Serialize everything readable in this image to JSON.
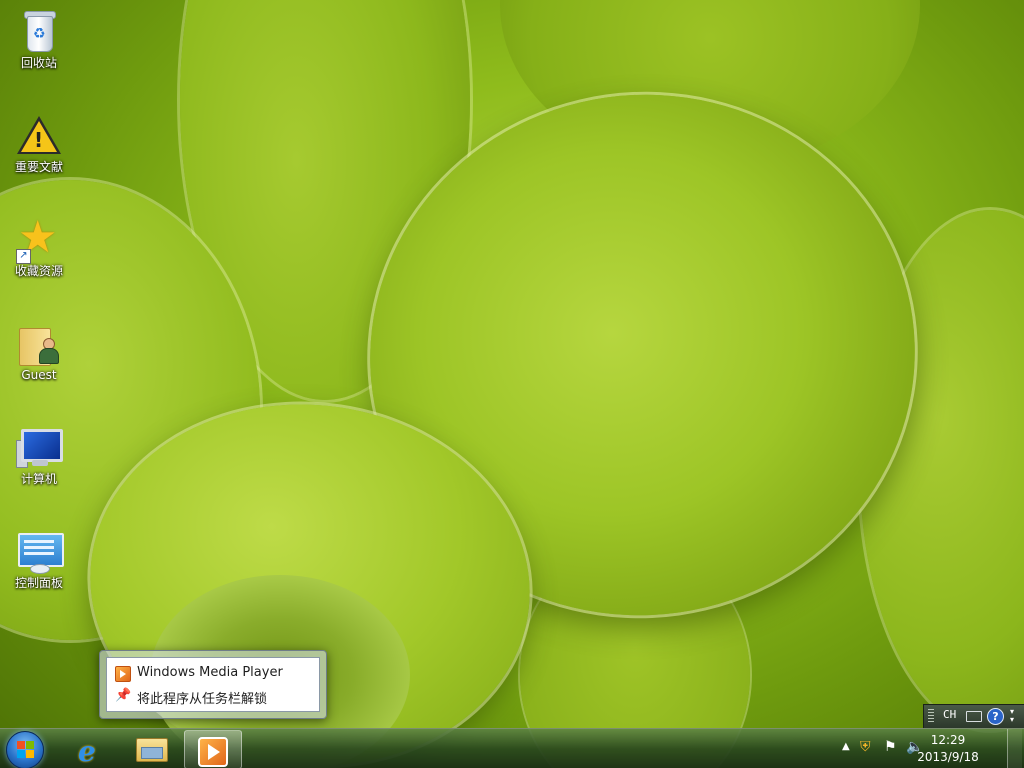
{
  "desktop": {
    "icons": [
      {
        "label": "回收站",
        "icon": "recycle-bin-icon"
      },
      {
        "label": "重要文献",
        "icon": "warning-icon"
      },
      {
        "label": "收藏资源",
        "icon": "star-icon"
      },
      {
        "label": "Guest",
        "icon": "user-folder-icon"
      },
      {
        "label": "计算机",
        "icon": "computer-icon"
      },
      {
        "label": "控制面板",
        "icon": "control-panel-icon"
      }
    ]
  },
  "jumplist": {
    "app_name": "Windows Media Player",
    "unpin_label": "将此程序从任务栏解锁"
  },
  "taskbar": {
    "pinned": [
      {
        "name": "Internet Explorer",
        "icon": "internet-explorer-icon"
      },
      {
        "name": "Windows Explorer",
        "icon": "folder-icon"
      },
      {
        "name": "Windows Media Player",
        "icon": "media-player-icon",
        "active": true
      }
    ],
    "clock": {
      "time": "12:29",
      "date": "2013/9/18"
    }
  },
  "language_bar": {
    "lang": "CH"
  }
}
